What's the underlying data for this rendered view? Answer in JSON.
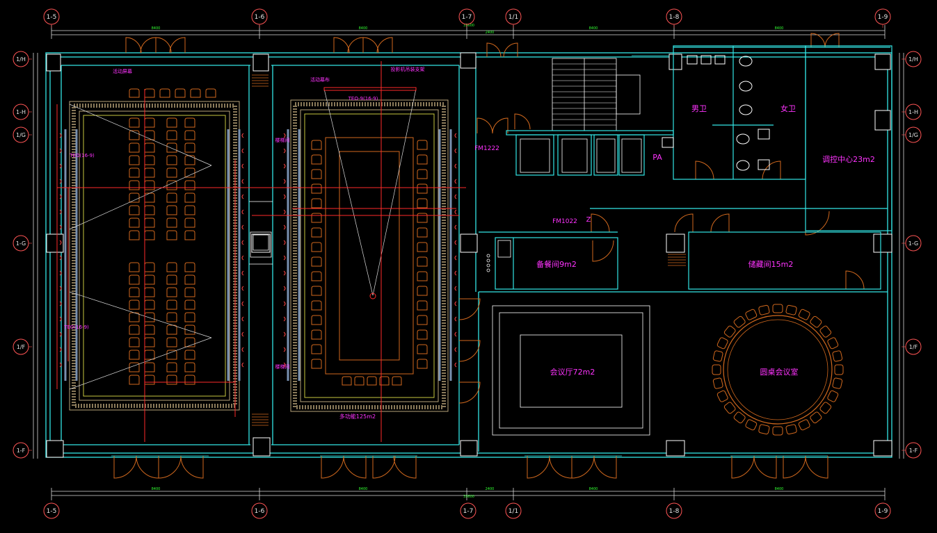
{
  "drawing": {
    "background": "#000000",
    "colors": {
      "wall": "#33e6e6",
      "structure": "#ffffff",
      "furniture": "#d2691e",
      "electrical": "#ff2a2a",
      "text": "#ff33ff",
      "grid_label": "#ff5555",
      "dimension": "#e6e6e6",
      "hatch": "#b8a37a"
    },
    "grid_top": [
      "1-5",
      "1-6",
      "1-7",
      "1/1",
      "1-8",
      "1-9"
    ],
    "grid_bottom": [
      "1-5",
      "1-6",
      "1-7",
      "1/1",
      "1-8",
      "1-9"
    ],
    "grid_left": [
      "1/H",
      "1-H",
      "1/G",
      "1-G",
      "1/F",
      "1-F"
    ],
    "grid_right": [
      "1/H",
      "1-H",
      "1/G",
      "1-G",
      "1/F",
      "1-F"
    ],
    "dims_top": [
      "8400",
      "8400",
      "2400",
      "8400",
      "8400"
    ],
    "dims_bottom": [
      "8400",
      "8400",
      "2400",
      "8400",
      "8400"
    ],
    "dim_total_top": "33600",
    "dim_total_bottom": "33600",
    "rooms": {
      "meeting_large": "会议厅72m2",
      "round_table": "圆桌会议室",
      "prep_room": "备餐间9m2",
      "storage": "储藏间15m2",
      "control_center": "调控中心23m2",
      "male_wc": "男卫",
      "female_wc": "女卫",
      "multi_function": "多功能125m2"
    },
    "labels": {
      "fm_upper": "FM1222",
      "fm_lower": "FM1022",
      "pa": "PA",
      "z_mark": "Z",
      "left_top_note": "活动屏幕",
      "mid_top_note": "活动幕布",
      "mid_top_note2": "投影机吊装支架",
      "projector_note": "TEO-9(16-9)",
      "left_note_upper": "TEO(16-9)",
      "left_note_lower": "TEO(16-9)",
      "stair_note_upper": "楼梯间",
      "stair_note_lower": "楼梯间"
    }
  }
}
